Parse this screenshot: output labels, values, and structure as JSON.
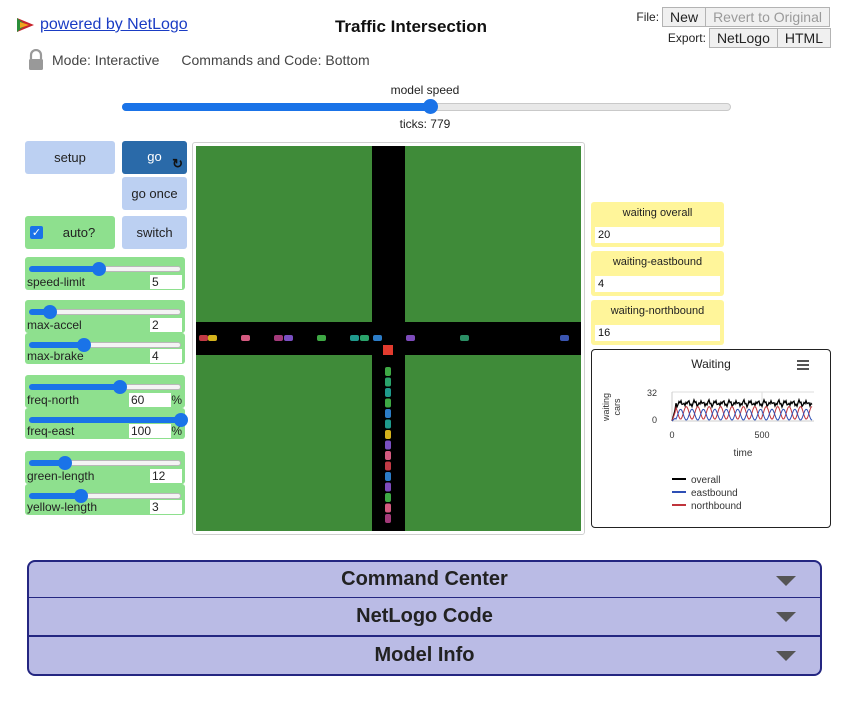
{
  "header": {
    "powered_by": "powered by NetLogo",
    "title": "Traffic Intersection",
    "file_label": "File:",
    "new_label": "New",
    "revert_label": "Revert to Original",
    "export_label": "Export:",
    "export_netlogo": "NetLogo",
    "export_html": "HTML",
    "mode": "Mode: Interactive",
    "commands_code": "Commands and Code: Bottom"
  },
  "speed": {
    "label": "model speed",
    "value_fraction": 0.505,
    "ticks": "ticks: 779"
  },
  "buttons": {
    "setup": "setup",
    "go": "go",
    "go_once": "go once",
    "switch": "switch",
    "forever_icon": "forever-loop-icon"
  },
  "auto_switch": {
    "label": "auto?",
    "checked": true
  },
  "sliders": [
    {
      "name": "speed-limit",
      "value": "5",
      "fraction": 0.46,
      "unit": ""
    },
    {
      "name": "max-accel",
      "value": "2",
      "fraction": 0.14,
      "unit": ""
    },
    {
      "name": "max-brake",
      "value": "4",
      "fraction": 0.36,
      "unit": ""
    },
    {
      "name": "freq-north",
      "value": "60",
      "fraction": 0.6,
      "unit": "%"
    },
    {
      "name": "freq-east",
      "value": "100",
      "fraction": 1.0,
      "unit": "%"
    },
    {
      "name": "green-length",
      "value": "12",
      "fraction": 0.24,
      "unit": ""
    },
    {
      "name": "yellow-length",
      "value": "3",
      "fraction": 0.34,
      "unit": ""
    }
  ],
  "monitors": [
    {
      "label": "waiting overall",
      "value": "20"
    },
    {
      "label": "waiting-eastbound",
      "value": "4"
    },
    {
      "label": "waiting-northbound",
      "value": "16"
    }
  ],
  "plot": {
    "title": "Waiting",
    "menu_icon": "hamburger-menu-icon",
    "ylabel_line1": "waiting",
    "ylabel_line2": "cars",
    "xlabel": "time",
    "y_max_tick": "32",
    "y_min_tick": "0",
    "x_min_tick": "0",
    "x_mid_tick": "500",
    "legend": [
      {
        "name": "overall",
        "color": "#000000"
      },
      {
        "name": "eastbound",
        "color": "#2e4fb5"
      },
      {
        "name": "northbound",
        "color": "#c0343c"
      }
    ]
  },
  "colors": {
    "accent": "#1a73e8",
    "button": "#bcd0f2",
    "go_button": "#2a6aa9",
    "slider_bg": "#8ee08e",
    "monitor_bg": "#fff59a",
    "world_grass": "#3f8b39",
    "road": "#000000",
    "section_bg": "#babbe5",
    "section_border": "#242681"
  },
  "sections": [
    {
      "label": "Command Center"
    },
    {
      "label": "NetLogo Code"
    },
    {
      "label": "Model Info"
    }
  ]
}
